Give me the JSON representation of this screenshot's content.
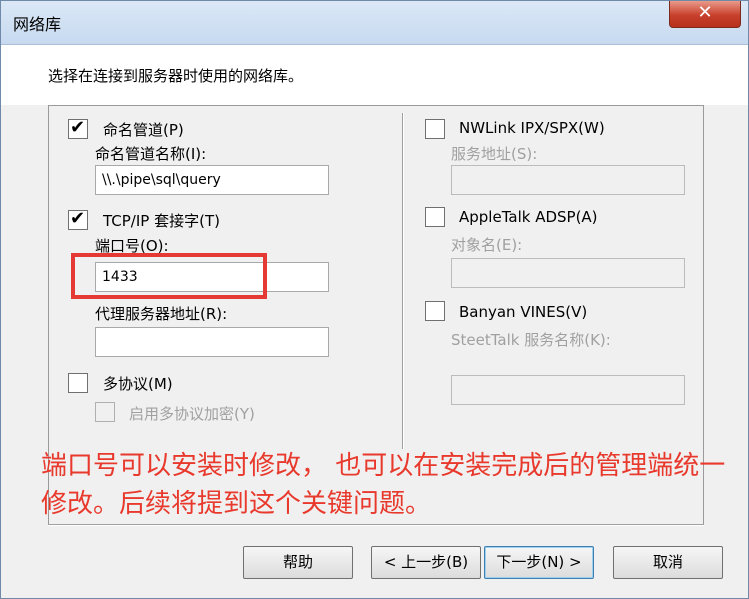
{
  "window": {
    "title": "网络库",
    "close_glyph": "✕"
  },
  "instruction": "选择在连接到服务器时使用的网络库。",
  "left": {
    "named_pipes": {
      "label": "命名管道(P)",
      "checked": true,
      "sub_label": "命名管道名称(I):",
      "value": "\\\\.\\pipe\\sql\\query"
    },
    "tcpip": {
      "label": "TCP/IP 套接字(T)",
      "checked": true,
      "port_label": "端口号(O):",
      "port_value": "1433",
      "proxy_label": "代理服务器地址(R):",
      "proxy_value": ""
    },
    "multiprotocol": {
      "label": "多协议(M)",
      "checked": false,
      "encrypt_label": "启用多协议加密(Y)"
    }
  },
  "right": {
    "nwlink": {
      "label": "NWLink IPX/SPX(W)",
      "sub_label": "服务地址(S):"
    },
    "appletalk": {
      "label": "AppleTalk ADSP(A)",
      "sub_label": "对象名(E):"
    },
    "banyan": {
      "label": "Banyan VINES(V)",
      "sub_label": "SteetTalk 服务名称(K):"
    }
  },
  "annotation": {
    "text": "端口号可以安装时修改， 也可以在安装完成后的管理端统一修改。后续将提到这个关键问题。",
    "color": "#e8392c"
  },
  "buttons": {
    "help": "帮助",
    "back": "< 上一步(B)",
    "next": "下一步(N) >",
    "cancel": "取消"
  },
  "check_glyph": "✔"
}
